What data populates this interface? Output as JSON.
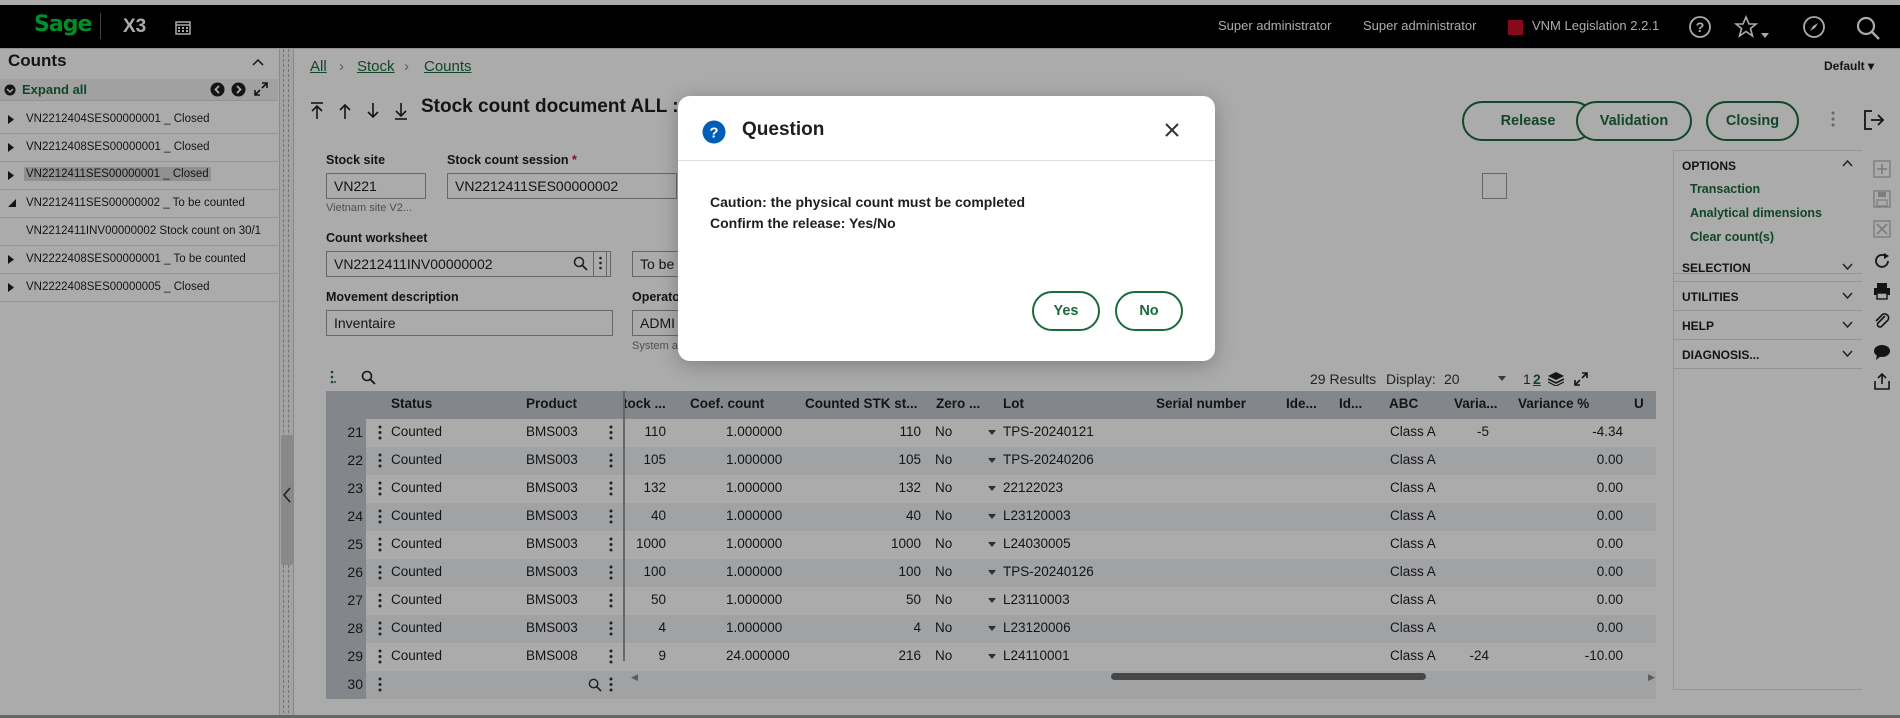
{
  "topbar": {
    "logo": "Sage",
    "product": "X3",
    "user1": "Super administrator",
    "user2": "Super administrator",
    "legislation": "VNM Legislation 2.2.1",
    "accent": "#00d639"
  },
  "left_panel": {
    "title": "Counts",
    "expand_all": "Expand all",
    "items": [
      {
        "label": "VN2212404SES00000001 _ Closed"
      },
      {
        "label": "VN2212408SES00000001 _ Closed"
      },
      {
        "label": "VN2212411SES00000001 _ Closed"
      },
      {
        "label": "VN2212411SES00000002 _ To be counted"
      },
      {
        "label": "VN2212411INV00000002 Stock count on 30/1"
      },
      {
        "label": "VN2222408SES00000001 _ To be counted"
      },
      {
        "label": "VN2222408SES00000005 _ Closed"
      }
    ]
  },
  "breadcrumb": {
    "all": "All",
    "stock": "Stock",
    "counts": "Counts"
  },
  "default_label": "Default",
  "page_title": "Stock count document ALL :",
  "actions": {
    "release": "Release",
    "validation": "Validation",
    "closing": "Closing"
  },
  "form": {
    "stock_site_label": "Stock site",
    "stock_site_value": "VN221",
    "stock_site_sub": "Vietnam site V2...",
    "session_label": "Stock count session",
    "required_mark": "*",
    "session_value": "VN2212411SES00000002",
    "worksheet_label": "Count worksheet",
    "worksheet_value": "VN2212411INV00000002",
    "status_value": "To be",
    "movement_label": "Movement description",
    "movement_value": "Inventaire",
    "operator_label": "Operato",
    "operator_value": "ADMI",
    "operator_sub": "System a"
  },
  "grid": {
    "results": "29 Results",
    "display_label": "Display:",
    "display_value": "20",
    "page_1": "1",
    "page_2": "2",
    "columns": [
      "Status",
      "Product",
      "tock ...",
      "Coef. count",
      "Counted STK st...",
      "Zero ...",
      "Lot",
      "Serial number",
      "Ide...",
      "Id...",
      "ABC",
      "Varia...",
      "Variance %",
      "U"
    ],
    "rows": [
      {
        "n": "21",
        "status": "Counted",
        "product": "BMS003",
        "stock": "110",
        "coef": "1.000000",
        "counted": "110",
        "zero": "No",
        "lot": "TPS-20240121",
        "abc": "Class A",
        "var": "-5",
        "varpct": "-4.34"
      },
      {
        "n": "22",
        "status": "Counted",
        "product": "BMS003",
        "stock": "105",
        "coef": "1.000000",
        "counted": "105",
        "zero": "No",
        "lot": "TPS-20240206",
        "abc": "Class A",
        "var": "",
        "varpct": "0.00"
      },
      {
        "n": "23",
        "status": "Counted",
        "product": "BMS003",
        "stock": "132",
        "coef": "1.000000",
        "counted": "132",
        "zero": "No",
        "lot": "22122023",
        "abc": "Class A",
        "var": "",
        "varpct": "0.00"
      },
      {
        "n": "24",
        "status": "Counted",
        "product": "BMS003",
        "stock": "40",
        "coef": "1.000000",
        "counted": "40",
        "zero": "No",
        "lot": "L23120003",
        "abc": "Class A",
        "var": "",
        "varpct": "0.00"
      },
      {
        "n": "25",
        "status": "Counted",
        "product": "BMS003",
        "stock": "1000",
        "coef": "1.000000",
        "counted": "1000",
        "zero": "No",
        "lot": "L24030005",
        "abc": "Class A",
        "var": "",
        "varpct": "0.00"
      },
      {
        "n": "26",
        "status": "Counted",
        "product": "BMS003",
        "stock": "100",
        "coef": "1.000000",
        "counted": "100",
        "zero": "No",
        "lot": "TPS-20240126",
        "abc": "Class A",
        "var": "",
        "varpct": "0.00"
      },
      {
        "n": "27",
        "status": "Counted",
        "product": "BMS003",
        "stock": "50",
        "coef": "1.000000",
        "counted": "50",
        "zero": "No",
        "lot": "L23110003",
        "abc": "Class A",
        "var": "",
        "varpct": "0.00"
      },
      {
        "n": "28",
        "status": "Counted",
        "product": "BMS003",
        "stock": "4",
        "coef": "1.000000",
        "counted": "4",
        "zero": "No",
        "lot": "L23120006",
        "abc": "Class A",
        "var": "",
        "varpct": "0.00"
      },
      {
        "n": "29",
        "status": "Counted",
        "product": "BMS008",
        "stock": "9",
        "coef": "24.000000",
        "counted": "216",
        "zero": "No",
        "lot": "L24110001",
        "abc": "Class A",
        "var": "-24",
        "varpct": "-10.00"
      }
    ],
    "new_row_number": "30"
  },
  "right_panel": {
    "options": "OPTIONS",
    "transaction": "Transaction",
    "analytical": "Analytical dimensions",
    "clear": "Clear count(s)",
    "selection": "SELECTION",
    "utilities": "UTILITIES",
    "help": "HELP",
    "diagnosis": "DIAGNOSIS..."
  },
  "dialog": {
    "title": "Question",
    "line1": "Caution: the physical count must be completed",
    "line2": "Confirm the release: Yes/No",
    "yes": "Yes",
    "no": "No",
    "icon_color": "#005eb8"
  }
}
